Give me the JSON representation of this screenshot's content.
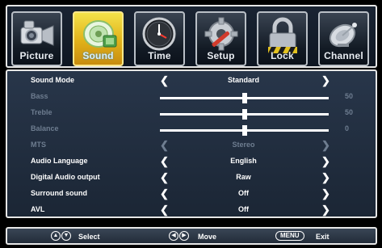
{
  "tabs": [
    {
      "label": "Picture",
      "icon": "camera-icon",
      "active": false
    },
    {
      "label": "Sound",
      "icon": "speaker-icon",
      "active": true
    },
    {
      "label": "Time",
      "icon": "clock-icon",
      "active": false
    },
    {
      "label": "Setup",
      "icon": "wrench-gear-icon",
      "active": false
    },
    {
      "label": "Lock",
      "icon": "padlock-icon",
      "active": false
    },
    {
      "label": "Channel",
      "icon": "satellite-dish-icon",
      "active": false
    }
  ],
  "settings": [
    {
      "label": "Sound Mode",
      "type": "select",
      "value": "Standard",
      "enabled": true
    },
    {
      "label": "Bass",
      "type": "slider",
      "value": "50",
      "level": 0.5,
      "enabled": false
    },
    {
      "label": "Treble",
      "type": "slider",
      "value": "50",
      "level": 0.5,
      "enabled": false
    },
    {
      "label": "Balance",
      "type": "slider",
      "value": "0",
      "level": 0.5,
      "enabled": false
    },
    {
      "label": "MTS",
      "type": "select",
      "value": "Stereo",
      "enabled": false
    },
    {
      "label": "Audio Language",
      "type": "select",
      "value": "English",
      "enabled": true
    },
    {
      "label": "Digital Audio output",
      "type": "select",
      "value": "Raw",
      "enabled": true
    },
    {
      "label": "Surround sound",
      "type": "select",
      "value": "Off",
      "enabled": true
    },
    {
      "label": "AVL",
      "type": "select",
      "value": "Off",
      "enabled": true
    }
  ],
  "help": {
    "select_label": "Select",
    "move_label": "Move",
    "menu_key": "MENU",
    "exit_label": "Exit"
  },
  "colors": {
    "active_tab": "#e0b11a",
    "panel_bg": "#28364a",
    "disabled_text": "#6e7d90",
    "text": "#ffffff"
  }
}
